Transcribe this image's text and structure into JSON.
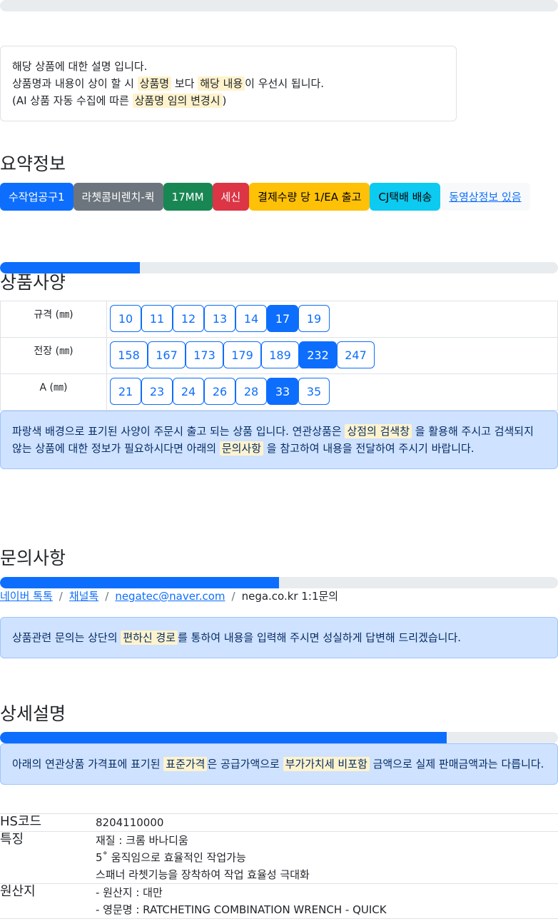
{
  "notice": {
    "line1": "해당 상품에 대한 설명 입니다.",
    "line2_a": "상품명과 내용이 상이 할 시 ",
    "line2_hl1": "상품명",
    "line2_b": " 보다 ",
    "line2_hl2": "해당 내용",
    "line2_c": "이 우선시 됩니다.",
    "line3_a": "(AI 상품 자동 수집에 따른 ",
    "line3_hl": "상품명 임의 변경시",
    "line3_b": ")"
  },
  "summary": {
    "title": "요약정보",
    "badges": [
      "수작업공구1",
      "라쳇콤비렌치-퀵",
      "17MM",
      "세신",
      "결제수량 당 1/EA 출고",
      "CJ택배 배송",
      "동영상정보 있음"
    ],
    "progress": 0.25
  },
  "spec": {
    "title": "상품사양",
    "rows": [
      {
        "label": "규격 (㎜)",
        "options": [
          "10",
          "11",
          "12",
          "13",
          "14",
          "17",
          "19"
        ],
        "selected": "17"
      },
      {
        "label": "전장 (㎜)",
        "options": [
          "158",
          "167",
          "173",
          "179",
          "189",
          "232",
          "247"
        ],
        "selected": "232"
      },
      {
        "label": "A (㎜)",
        "options": [
          "21",
          "23",
          "24",
          "26",
          "28",
          "33",
          "35"
        ],
        "selected": "33"
      }
    ],
    "alert_a": "파랑색 배경으로 표기된 사양이 주문시 출고 되는 상품 입니다. 연관상품은 ",
    "alert_hl1": "상점의 검색창",
    "alert_b": " 을 활용해 주시고 검색되지 않는 상품에 대한 정보가 필요하시다면 아래의 ",
    "alert_hl2": "문의사항",
    "alert_c": " 을 참고하여 내용을 전달하여 주시기 바랍니다."
  },
  "inquiry": {
    "title": "문의사항",
    "progress": 0.5,
    "links": [
      "네이버 톡톡",
      "채널톡",
      "negatec@naver.com"
    ],
    "last": "nega.co.kr 1:1문의",
    "sep": "/",
    "alert_a": "상품관련 문의는 상단의 ",
    "alert_hl": "편하신 경로",
    "alert_b": "를 통하여 내용을 입력해 주시면 성실하게 답변해 드리겠습니다."
  },
  "detail": {
    "title": "상세설명",
    "progress": 0.8,
    "alert_a": "아래의 연관상품 가격표에 표기된 ",
    "alert_hl1": "표준가격",
    "alert_b": "은 공급가액으로 ",
    "alert_hl2": "부가가치세 비포함",
    "alert_c": " 금액으로 실제 판매금액과는 다릅니다.",
    "rows": [
      {
        "key": "HS코드",
        "values": [
          "8204110000"
        ]
      },
      {
        "key": "특징",
        "values": [
          "재질 : 크롬 바나디움",
          "5˚ 움직임으로 효율적인 작업가능",
          "스패너 라쳇기능을 장착하여 작업 효율성 극대화"
        ]
      },
      {
        "key": "원산지",
        "values": [
          "- 원산지 : 대만",
          "- 영문명 : RATCHETING COMBINATION WRENCH - QUICK"
        ]
      }
    ]
  }
}
